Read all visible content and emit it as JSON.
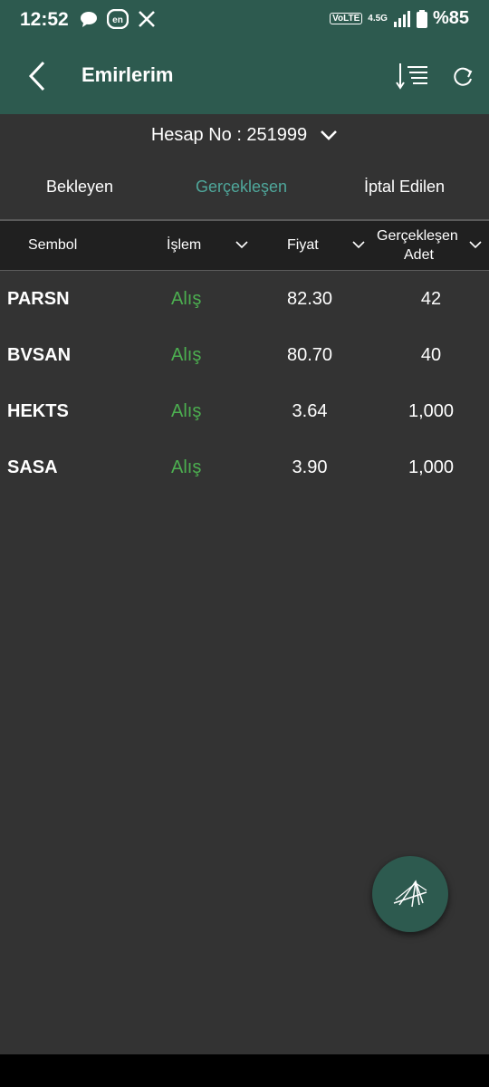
{
  "status_bar": {
    "time": "12:52",
    "network": "4.5G",
    "volte": "VoLTE",
    "battery": "%85",
    "icons": [
      "chat-icon",
      "en-keyboard-icon",
      "x-logo-icon"
    ]
  },
  "app_bar": {
    "title": "Emirlerim"
  },
  "account": {
    "label": "Hesap No : 251999"
  },
  "tabs": [
    {
      "label": "Bekleyen",
      "active": false
    },
    {
      "label": "Gerçekleşen",
      "active": true
    },
    {
      "label": "İptal Edilen",
      "active": false
    }
  ],
  "table": {
    "headers": {
      "symbol": "Sembol",
      "side": "İşlem",
      "price": "Fiyat",
      "qty_line1": "Gerçekleşen",
      "qty_line2": "Adet"
    },
    "rows": [
      {
        "symbol": "PARSN",
        "side": "Alış",
        "price": "82.30",
        "qty": "42"
      },
      {
        "symbol": "BVSAN",
        "side": "Alış",
        "price": "80.70",
        "qty": "40"
      },
      {
        "symbol": "HEKTS",
        "side": "Alış",
        "price": "3.64",
        "qty": "1,000"
      },
      {
        "symbol": "SASA",
        "side": "Alış",
        "price": "3.90",
        "qty": "1,000"
      }
    ]
  },
  "colors": {
    "primary": "#2d5a4f",
    "active_tab": "#4fa79b",
    "buy": "#4caf50",
    "background": "#333333"
  },
  "fab": {
    "icon": "bridge-icon"
  }
}
